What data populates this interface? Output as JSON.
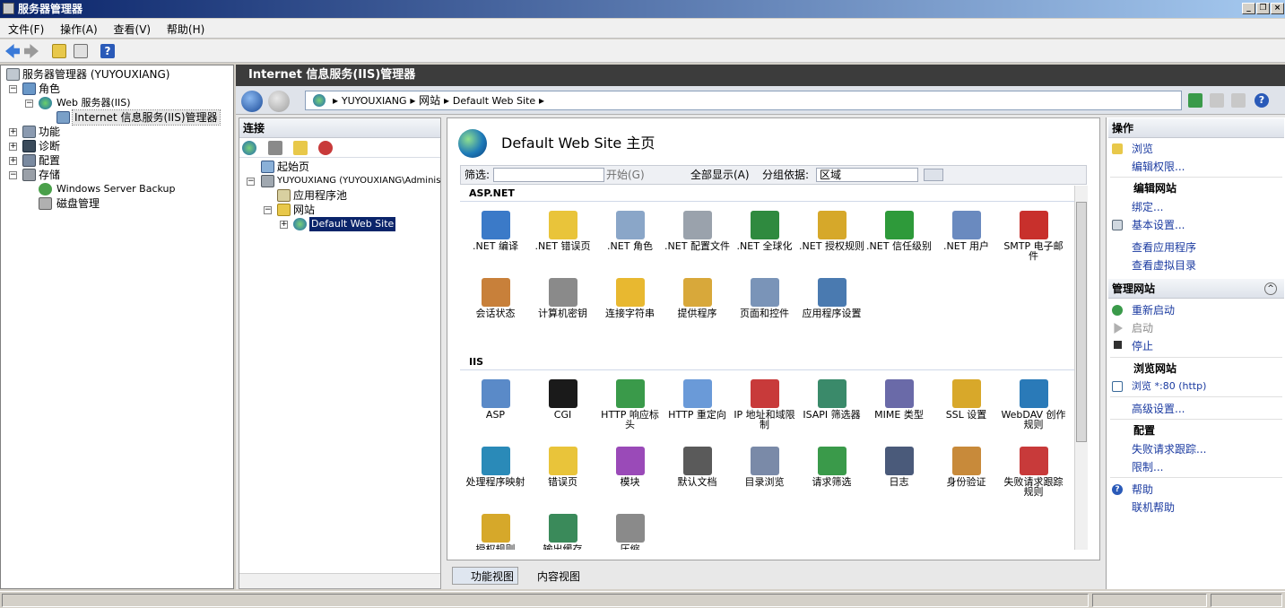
{
  "window": {
    "title": "服务器管理器",
    "controls": [
      "_",
      "❐",
      "×"
    ]
  },
  "menu": [
    "文件(F)",
    "操作(A)",
    "查看(V)",
    "帮助(H)"
  ],
  "tree": {
    "items": [
      {
        "label": "服务器管理器 (YUYOUXIANG)",
        "icon": "server-manager-icon"
      },
      {
        "label": "角色",
        "icon": "roles-icon"
      },
      {
        "label": "Web 服务器(IIS)",
        "icon": "web-server-icon"
      },
      {
        "label": "Internet 信息服务(IIS)管理器",
        "icon": "iis-manager-icon"
      },
      {
        "label": "功能",
        "icon": "features-icon"
      },
      {
        "label": "诊断",
        "icon": "diagnostics-icon"
      },
      {
        "label": "配置",
        "icon": "configuration-icon"
      },
      {
        "label": "存储",
        "icon": "storage-icon"
      },
      {
        "label": "Windows Server Backup",
        "icon": "backup-icon"
      },
      {
        "label": "磁盘管理",
        "icon": "disk-management-icon"
      }
    ]
  },
  "iis": {
    "title": "Internet 信息服务(IIS)管理器",
    "breadcrumb": [
      "YUYOUXIANG",
      "网站",
      "Default Web Site"
    ]
  },
  "connections": {
    "header": "连接",
    "items": [
      {
        "label": "起始页"
      },
      {
        "label": "YUYOUXIANG (YUYOUXIANG\\Adminis"
      },
      {
        "label": "应用程序池"
      },
      {
        "label": "网站"
      },
      {
        "label": "Default Web Site"
      }
    ]
  },
  "main": {
    "title": "Default Web Site 主页",
    "filter": {
      "label": "筛选:",
      "value": "",
      "go": "开始(G)",
      "showall": "全部显示(A)",
      "groupby": "分组依据:",
      "groupvalue": "区域"
    },
    "groups": [
      {
        "name": "ASP.NET"
      },
      {
        "name": "IIS"
      }
    ],
    "aspnet": [
      {
        "label": ".NET 编译",
        "color": "#3b7ac8"
      },
      {
        "label": ".NET 错误页",
        "color": "#e9c43a"
      },
      {
        "label": ".NET 角色",
        "color": "#8aa6c8"
      },
      {
        "label": ".NET 配置文件",
        "color": "#9aa2ac"
      },
      {
        "label": ".NET 全球化",
        "color": "#2f8a3f"
      },
      {
        "label": ".NET 授权规则",
        "color": "#d6a82a"
      },
      {
        "label": ".NET 信任级别",
        "color": "#2e9a3a"
      },
      {
        "label": ".NET 用户",
        "color": "#6a8abf"
      },
      {
        "label": "SMTP 电子邮件",
        "color": "#c8302c"
      },
      {
        "label": "会话状态",
        "color": "#c8803a"
      },
      {
        "label": "计算机密钥",
        "color": "#8a8a8a"
      },
      {
        "label": "连接字符串",
        "color": "#e8b830"
      },
      {
        "label": "提供程序",
        "color": "#d8a83a"
      },
      {
        "label": "页面和控件",
        "color": "#7a94b8"
      },
      {
        "label": "应用程序设置",
        "color": "#4a7ab0"
      }
    ],
    "iis": [
      {
        "label": "ASP",
        "color": "#5a8ac8"
      },
      {
        "label": "CGI",
        "color": "#1a1a1a"
      },
      {
        "label": "HTTP 响应标头",
        "color": "#3a9a4a"
      },
      {
        "label": "HTTP 重定向",
        "color": "#6a9ad8"
      },
      {
        "label": "IP 地址和域限制",
        "color": "#c83a3a"
      },
      {
        "label": "ISAPI 筛选器",
        "color": "#3a8a6a"
      },
      {
        "label": "MIME 类型",
        "color": "#6a6aa8"
      },
      {
        "label": "SSL 设置",
        "color": "#d8a82a"
      },
      {
        "label": "WebDAV 创作规则",
        "color": "#2a7ab8"
      },
      {
        "label": "处理程序映射",
        "color": "#2a8ab8"
      },
      {
        "label": "错误页",
        "color": "#e9c43a"
      },
      {
        "label": "模块",
        "color": "#9a4ab8"
      },
      {
        "label": "默认文档",
        "color": "#5a5a5a"
      },
      {
        "label": "目录浏览",
        "color": "#7a8aa8"
      },
      {
        "label": "请求筛选",
        "color": "#3a9a4a"
      },
      {
        "label": "日志",
        "color": "#4a5a7a"
      },
      {
        "label": "身份验证",
        "color": "#c88a3a"
      },
      {
        "label": "失败请求跟踪规则",
        "color": "#c83a3a"
      },
      {
        "label": "授权规则",
        "color": "#d6a82a"
      },
      {
        "label": "输出缓存",
        "color": "#3a8a5a"
      },
      {
        "label": "压缩",
        "color": "#8a8a8a"
      }
    ],
    "tabs": [
      "功能视图",
      "内容视图"
    ]
  },
  "actions": {
    "header": "操作",
    "browse": "浏览",
    "editperm": "编辑权限...",
    "editsite_head": "编辑网站",
    "bind": "绑定...",
    "basic": "基本设置...",
    "viewapps": "查看应用程序",
    "viewvdirs": "查看虚拟目录",
    "manage_head": "管理网站",
    "restart": "重新启动",
    "start": "启动",
    "stop": "停止",
    "browsesite_head": "浏览网站",
    "browse80": "浏览 *:80 (http)",
    "advanced": "高级设置...",
    "config_head": "配置",
    "failedreq": "失败请求跟踪...",
    "limits": "限制...",
    "help": "帮助",
    "onlinehelp": "联机帮助"
  }
}
